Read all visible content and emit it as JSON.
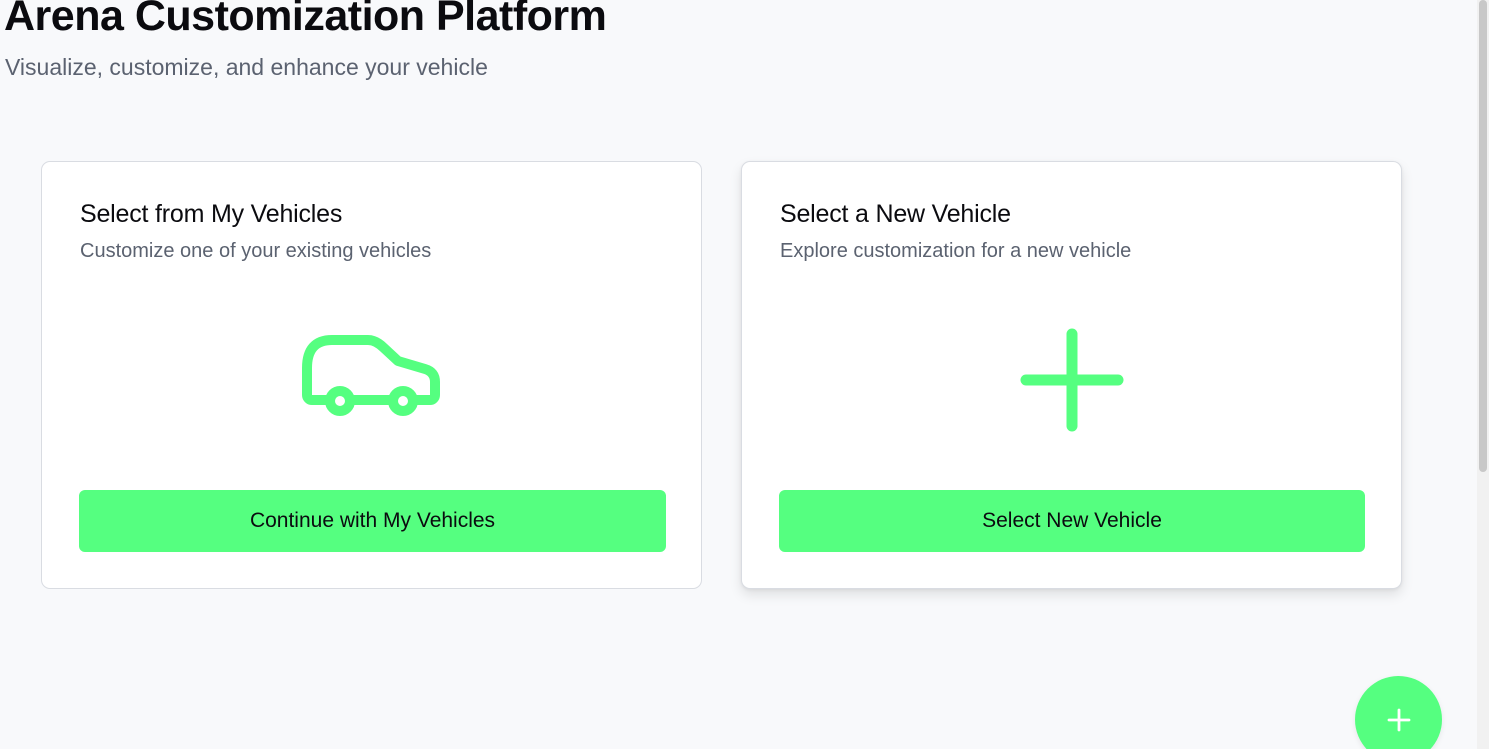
{
  "header": {
    "title": "Arena Customization Platform",
    "subtitle": "Visualize, customize, and enhance your vehicle"
  },
  "cards": [
    {
      "title": "Select from My Vehicles",
      "description": "Customize one of your existing vehicles",
      "icon": "car-icon",
      "button_label": "Continue with My Vehicles"
    },
    {
      "title": "Select a New Vehicle",
      "description": "Explore customization for a new vehicle",
      "icon": "plus-icon",
      "button_label": "Select New Vehicle"
    }
  ],
  "fab": {
    "icon": "plus-icon"
  },
  "colors": {
    "accent": "#55ff80",
    "background": "#f8f9fb",
    "card": "#ffffff",
    "muted_text": "#5b6270",
    "text": "#0b0b0f"
  }
}
